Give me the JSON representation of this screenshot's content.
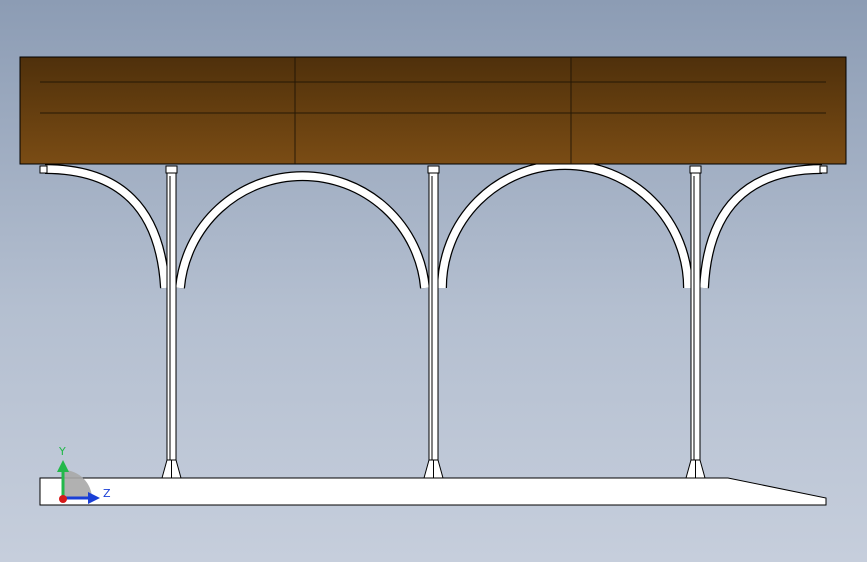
{
  "viewport": {
    "background_top": "#8c9cb4",
    "background_bottom": "#c6cedc"
  },
  "roof": {
    "wood_top": "#4f300b",
    "wood_bottom": "#7a4c14",
    "panel_count": 3
  },
  "frame": {
    "color": "#ffffff",
    "outline": "#000000"
  },
  "triad": {
    "y_label": "Y",
    "z_label": "Z",
    "y_color": "#22b84a",
    "z_color": "#1a3fd6",
    "x_color": "#d61a1a"
  }
}
